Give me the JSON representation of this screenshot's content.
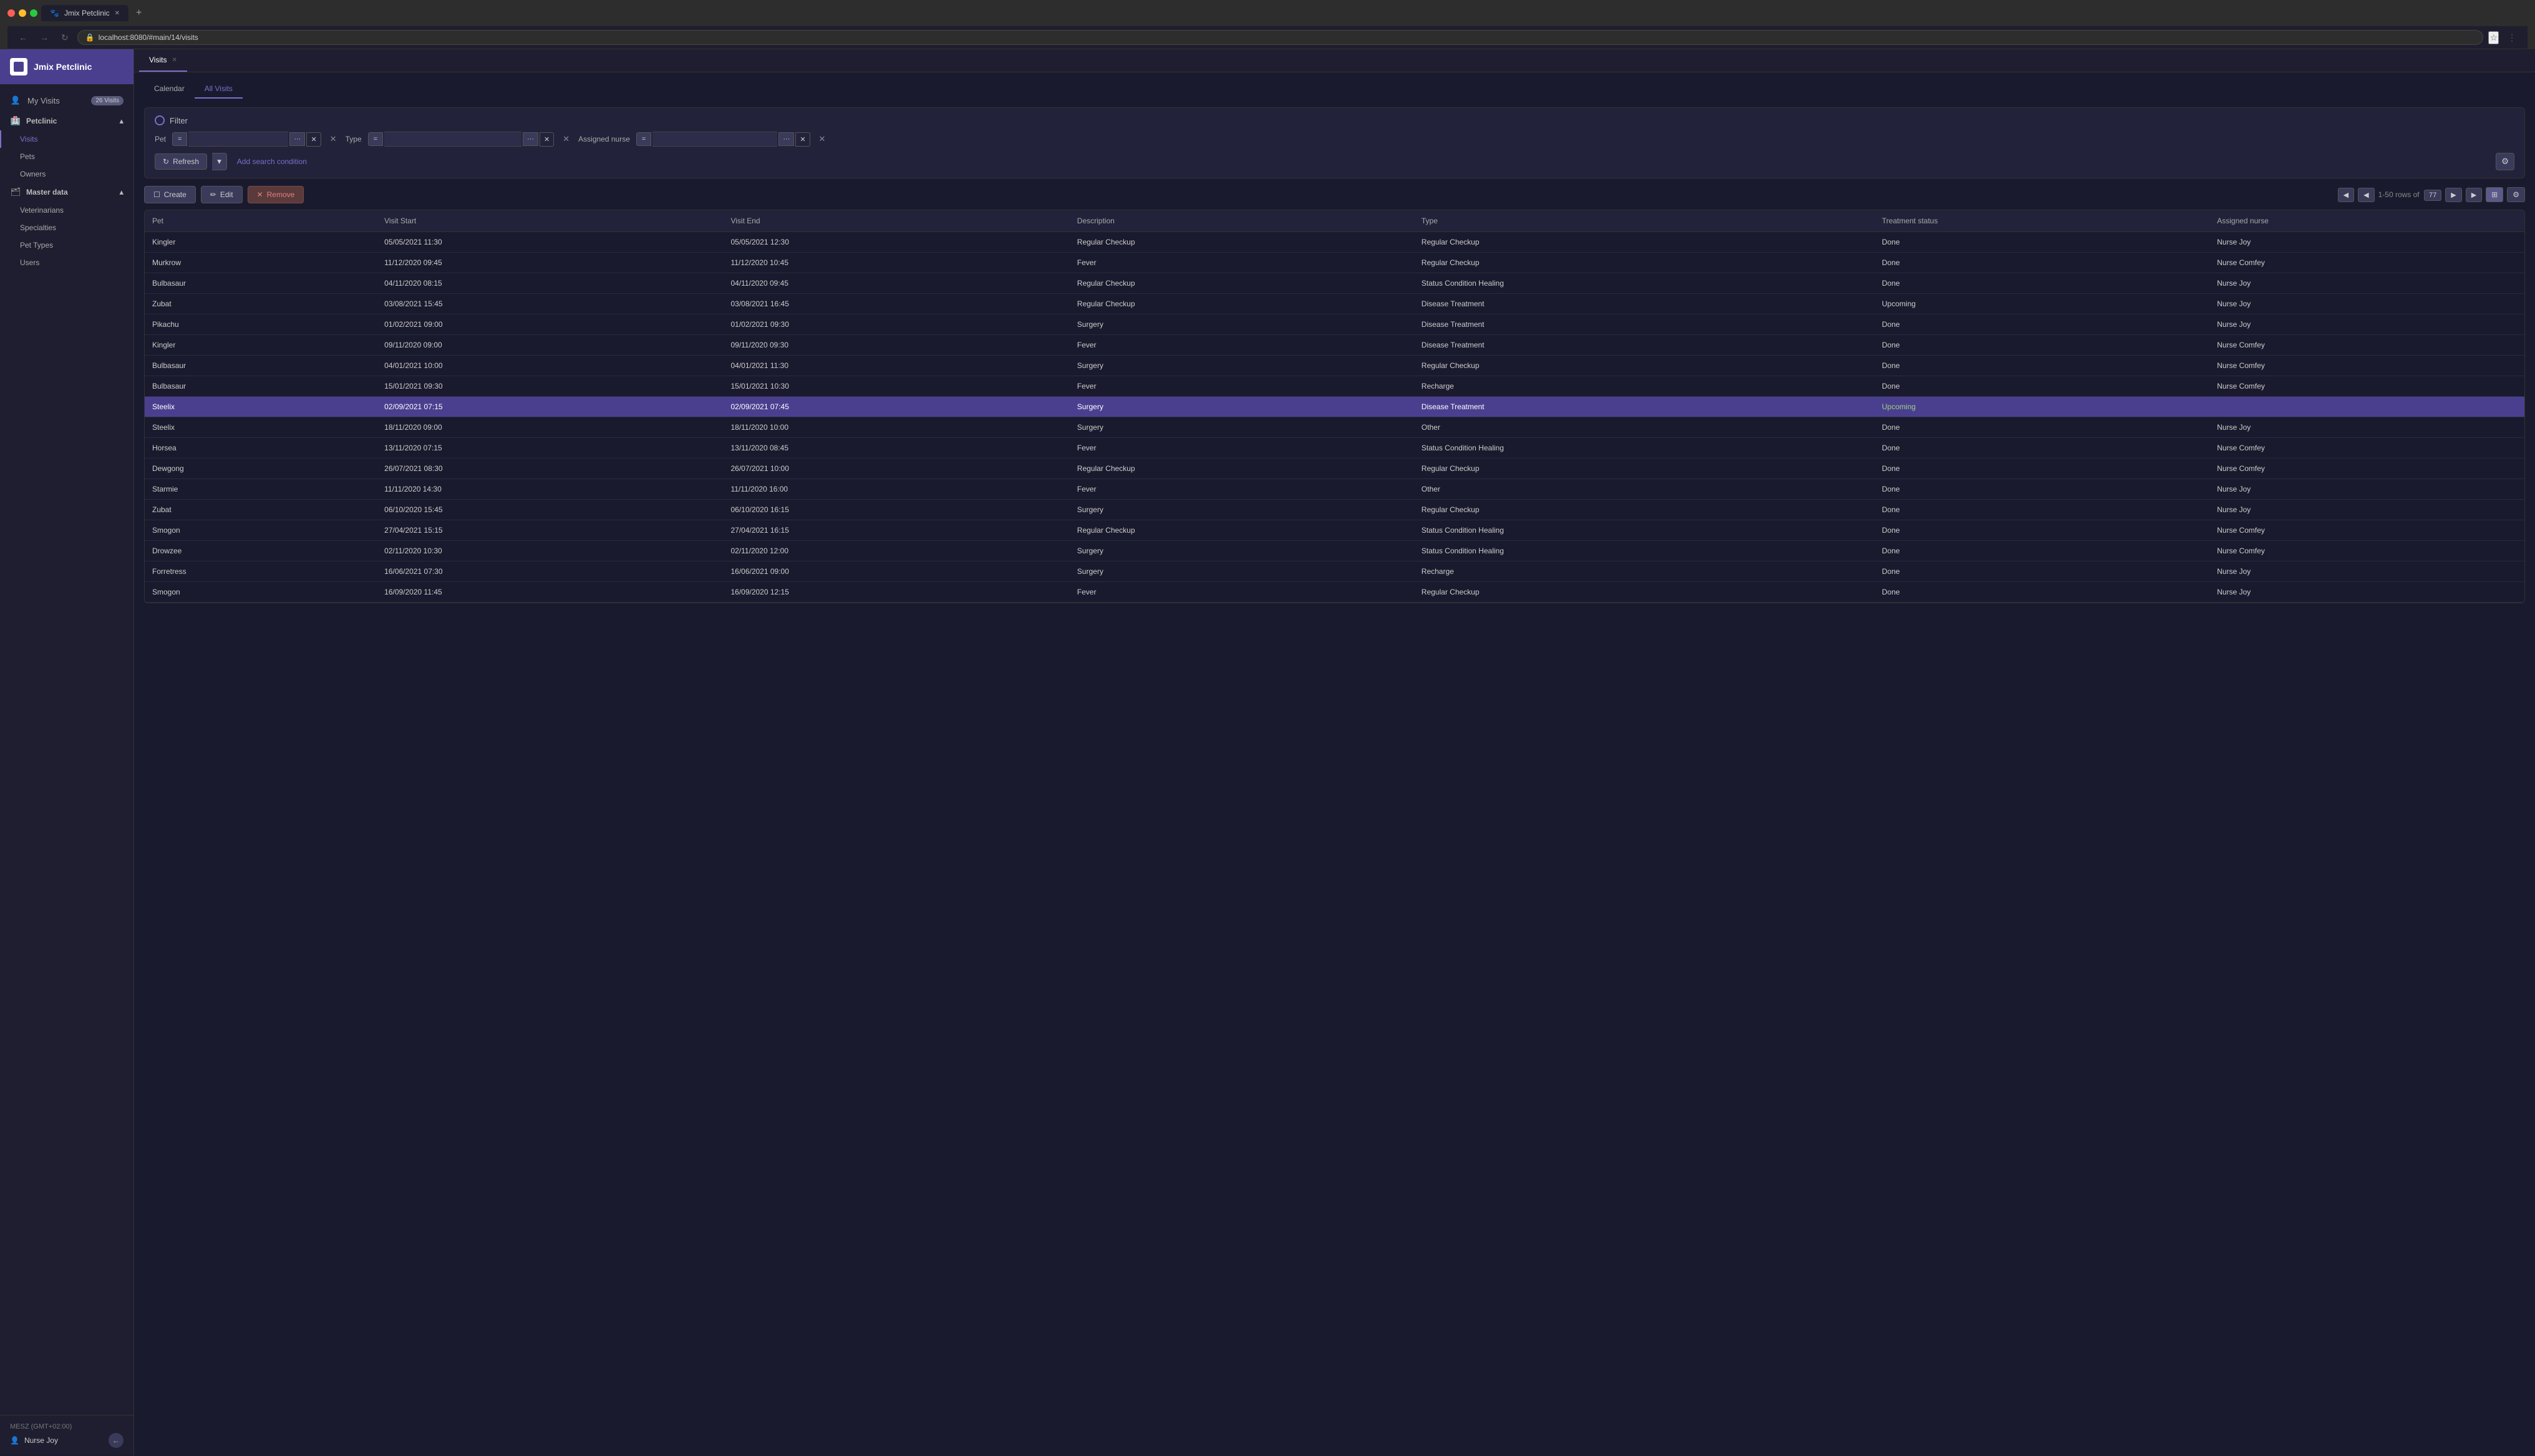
{
  "browser": {
    "url": "localhost:8080/#main/14/visits",
    "tab_title": "Jmix Petclinic",
    "tab_favicon": "🐾"
  },
  "sidebar": {
    "title": "Jmix Petclinic",
    "my_visits_label": "My Visits",
    "my_visits_badge": "26 Visits",
    "sections": [
      {
        "name": "petclinic",
        "label": "Petclinic",
        "items": [
          "Visits",
          "Pets",
          "Owners"
        ]
      },
      {
        "name": "master_data",
        "label": "Master data",
        "items": [
          "Veterinarians",
          "Specialties",
          "Pet Types",
          "Users"
        ]
      }
    ],
    "footer_time": "MESZ (GMT+02:00)",
    "footer_user": "Nurse Joy"
  },
  "main_tab": "Visits",
  "view_tabs": [
    "Calendar",
    "All Visits"
  ],
  "active_view_tab": "All Visits",
  "filter": {
    "title": "Filter",
    "pet_label": "Pet",
    "pet_eq": "=",
    "pet_value": "",
    "type_label": "Type",
    "type_eq": "=",
    "type_value": "",
    "assigned_nurse_label": "Assigned nurse",
    "assigned_nurse_eq": "=",
    "assigned_nurse_value": "",
    "refresh_label": "Refresh",
    "add_condition_label": "Add search condition"
  },
  "toolbar": {
    "create_label": "Create",
    "edit_label": "Edit",
    "remove_label": "Remove",
    "rows_info": "1-50 rows of",
    "rows_badge": "77"
  },
  "table": {
    "columns": [
      "Pet",
      "Visit Start",
      "Visit End",
      "Description",
      "Type",
      "Treatment status",
      "Assigned nurse"
    ],
    "rows": [
      {
        "pet": "Kingler",
        "visit_start": "05/05/2021 11:30",
        "visit_end": "05/05/2021 12:30",
        "description": "Regular Checkup",
        "type": "Regular Checkup",
        "status": "Done",
        "nurse": "Nurse Joy",
        "selected": false
      },
      {
        "pet": "Murkrow",
        "visit_start": "11/12/2020 09:45",
        "visit_end": "11/12/2020 10:45",
        "description": "Fever",
        "type": "Regular Checkup",
        "status": "Done",
        "nurse": "Nurse Comfey",
        "selected": false
      },
      {
        "pet": "Bulbasaur",
        "visit_start": "04/11/2020 08:15",
        "visit_end": "04/11/2020 09:45",
        "description": "Regular Checkup",
        "type": "Status Condition Healing",
        "status": "Done",
        "nurse": "Nurse Joy",
        "selected": false
      },
      {
        "pet": "Zubat",
        "visit_start": "03/08/2021 15:45",
        "visit_end": "03/08/2021 16:45",
        "description": "Regular Checkup",
        "type": "Disease Treatment",
        "status": "Upcoming",
        "nurse": "Nurse Joy",
        "selected": false
      },
      {
        "pet": "Pikachu",
        "visit_start": "01/02/2021 09:00",
        "visit_end": "01/02/2021 09:30",
        "description": "Surgery",
        "type": "Disease Treatment",
        "status": "Done",
        "nurse": "Nurse Joy",
        "selected": false
      },
      {
        "pet": "Kingler",
        "visit_start": "09/11/2020 09:00",
        "visit_end": "09/11/2020 09:30",
        "description": "Fever",
        "type": "Disease Treatment",
        "status": "Done",
        "nurse": "Nurse Comfey",
        "selected": false
      },
      {
        "pet": "Bulbasaur",
        "visit_start": "04/01/2021 10:00",
        "visit_end": "04/01/2021 11:30",
        "description": "Surgery",
        "type": "Regular Checkup",
        "status": "Done",
        "nurse": "Nurse Comfey",
        "selected": false
      },
      {
        "pet": "Bulbasaur",
        "visit_start": "15/01/2021 09:30",
        "visit_end": "15/01/2021 10:30",
        "description": "Fever",
        "type": "Recharge",
        "status": "Done",
        "nurse": "Nurse Comfey",
        "selected": false
      },
      {
        "pet": "Steelix",
        "visit_start": "02/09/2021 07:15",
        "visit_end": "02/09/2021 07:45",
        "description": "Surgery",
        "type": "Disease Treatment",
        "status": "Upcoming",
        "nurse": "",
        "selected": true
      },
      {
        "pet": "Steelix",
        "visit_start": "18/11/2020 09:00",
        "visit_end": "18/11/2020 10:00",
        "description": "Surgery",
        "type": "Other",
        "status": "Done",
        "nurse": "Nurse Joy",
        "selected": false
      },
      {
        "pet": "Horsea",
        "visit_start": "13/11/2020 07:15",
        "visit_end": "13/11/2020 08:45",
        "description": "Fever",
        "type": "Status Condition Healing",
        "status": "Done",
        "nurse": "Nurse Comfey",
        "selected": false
      },
      {
        "pet": "Dewgong",
        "visit_start": "26/07/2021 08:30",
        "visit_end": "26/07/2021 10:00",
        "description": "Regular Checkup",
        "type": "Regular Checkup",
        "status": "Done",
        "nurse": "Nurse Comfey",
        "selected": false
      },
      {
        "pet": "Starmie",
        "visit_start": "11/11/2020 14:30",
        "visit_end": "11/11/2020 16:00",
        "description": "Fever",
        "type": "Other",
        "status": "Done",
        "nurse": "Nurse Joy",
        "selected": false
      },
      {
        "pet": "Zubat",
        "visit_start": "06/10/2020 15:45",
        "visit_end": "06/10/2020 16:15",
        "description": "Surgery",
        "type": "Regular Checkup",
        "status": "Done",
        "nurse": "Nurse Joy",
        "selected": false
      },
      {
        "pet": "Smogon",
        "visit_start": "27/04/2021 15:15",
        "visit_end": "27/04/2021 16:15",
        "description": "Regular Checkup",
        "type": "Status Condition Healing",
        "status": "Done",
        "nurse": "Nurse Comfey",
        "selected": false
      },
      {
        "pet": "Drowzee",
        "visit_start": "02/11/2020 10:30",
        "visit_end": "02/11/2020 12:00",
        "description": "Surgery",
        "type": "Status Condition Healing",
        "status": "Done",
        "nurse": "Nurse Comfey",
        "selected": false
      },
      {
        "pet": "Forretress",
        "visit_start": "16/06/2021 07:30",
        "visit_end": "16/06/2021 09:00",
        "description": "Surgery",
        "type": "Recharge",
        "status": "Done",
        "nurse": "Nurse Joy",
        "selected": false
      },
      {
        "pet": "Smogon",
        "visit_start": "16/09/2020 11:45",
        "visit_end": "16/09/2020 12:15",
        "description": "Fever",
        "type": "Regular Checkup",
        "status": "Done",
        "nurse": "Nurse Joy",
        "selected": false
      }
    ]
  }
}
